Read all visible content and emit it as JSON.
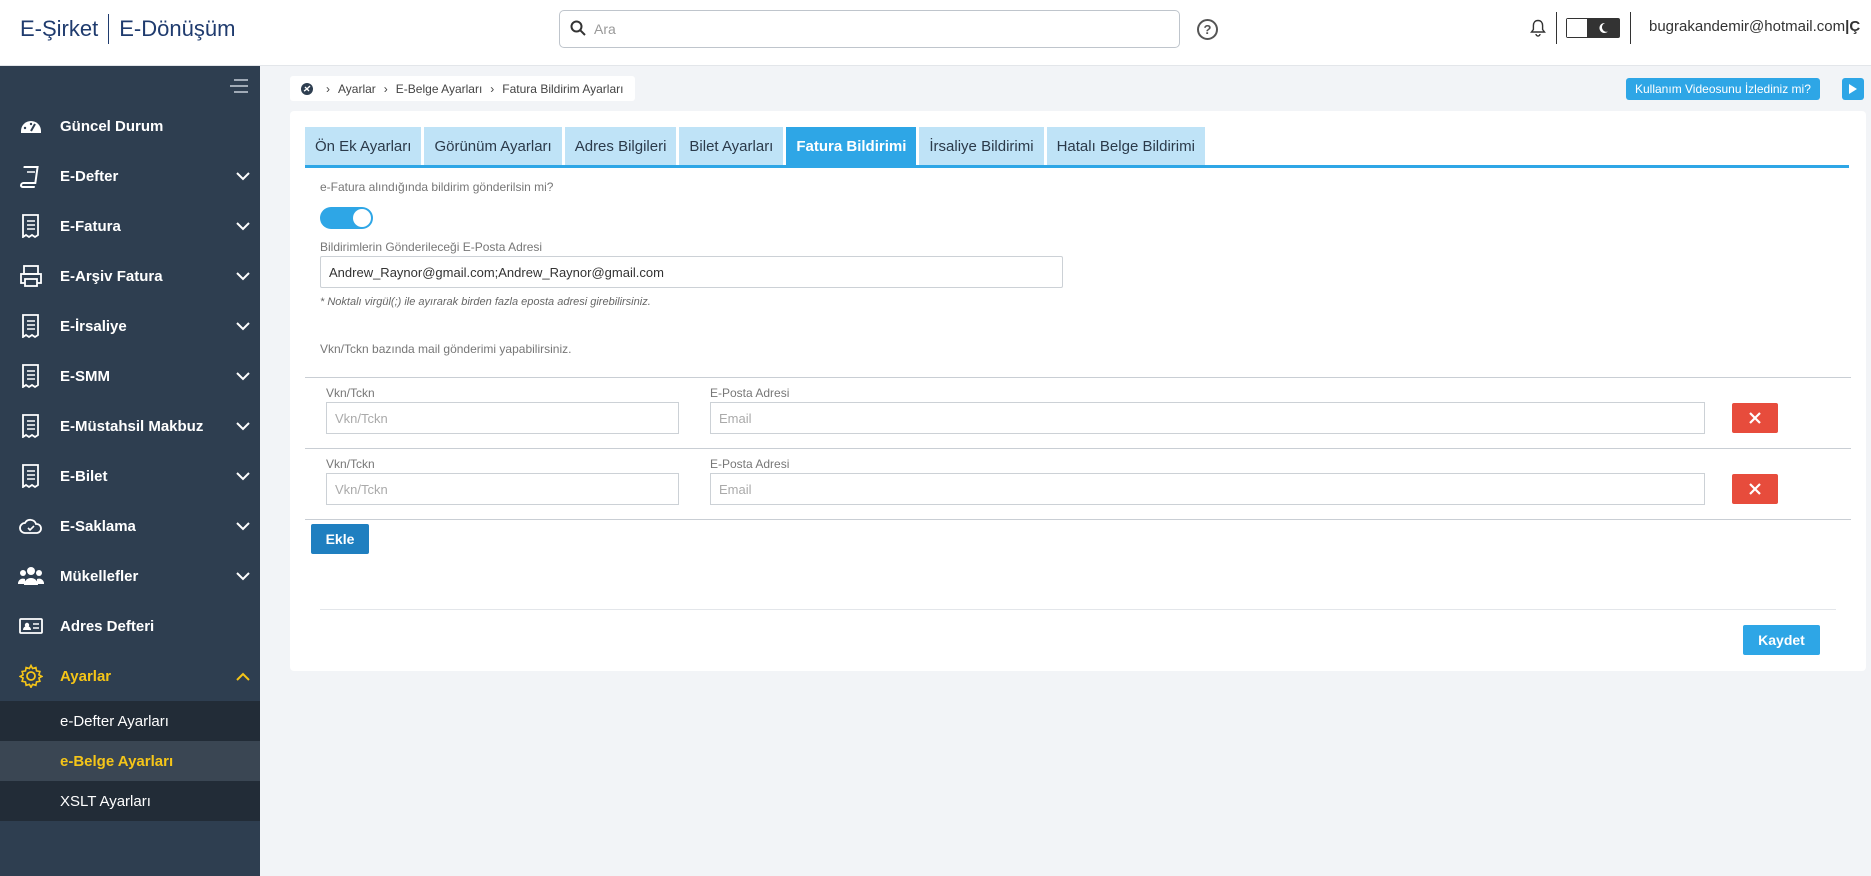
{
  "header": {
    "brand_left": "E-Şirket",
    "brand_right": "E-Dönüşüm",
    "search_placeholder": "Ara",
    "help_label": "?",
    "user_email": "bugrakandemir@hotmail.com",
    "user_suffix": "|Ç"
  },
  "sidebar": {
    "items": [
      {
        "label": "Güncel Durum",
        "icon": "dashboard-icon"
      },
      {
        "label": "E-Defter",
        "icon": "book-icon"
      },
      {
        "label": "E-Fatura",
        "icon": "receipt-icon"
      },
      {
        "label": "E-Arşiv Fatura",
        "icon": "printer-icon"
      },
      {
        "label": "E-İrsaliye",
        "icon": "receipt-icon"
      },
      {
        "label": "E-SMM",
        "icon": "receipt-icon"
      },
      {
        "label": "E-Müstahsil Makbuz",
        "icon": "receipt-icon"
      },
      {
        "label": "E-Bilet",
        "icon": "receipt-icon"
      },
      {
        "label": "E-Saklama",
        "icon": "cloud-icon"
      },
      {
        "label": "Mükellefler",
        "icon": "users-icon"
      },
      {
        "label": "Adres Defteri",
        "icon": "address-card-icon"
      },
      {
        "label": "Ayarlar",
        "icon": "gear-icon"
      }
    ],
    "subitems": [
      {
        "label": "e-Defter Ayarları"
      },
      {
        "label": "e-Belge Ayarları"
      },
      {
        "label": "XSLT Ayarları"
      }
    ]
  },
  "breadcrumb": {
    "items": [
      "Ayarlar",
      "E-Belge Ayarları",
      "Fatura Bildirim Ayarları"
    ]
  },
  "video_button": "Kullanım Videosunu İzlediniz mi?",
  "tabs": [
    {
      "label": "Ön Ek Ayarları"
    },
    {
      "label": "Görünüm Ayarları"
    },
    {
      "label": "Adres Bilgileri"
    },
    {
      "label": "Bilet Ayarları"
    },
    {
      "label": "Fatura Bildirimi",
      "active": true
    },
    {
      "label": "İrsaliye Bildirimi"
    },
    {
      "label": "Hatalı Belge Bildirimi"
    }
  ],
  "form": {
    "question": "e-Fatura alındığında bildirim gönderilsin mi?",
    "toggle_on": true,
    "email_label": "Bildirimlerin Gönderileceği E-Posta Adresi",
    "email_value": "Andrew_Raynor@gmail.com;Andrew_Raynor@gmail.com",
    "hint": "* Noktalı virgül(;) ile ayırarak birden fazla eposta adresi girebilirsiniz.",
    "vkn_note": "Vkn/Tckn bazında mail gönderimi yapabilirsiniz.",
    "rows": [
      {
        "vkn_label": "Vkn/Tckn",
        "vkn_placeholder": "Vkn/Tckn",
        "email_label": "E-Posta Adresi",
        "email_placeholder": "Email"
      },
      {
        "vkn_label": "Vkn/Tckn",
        "vkn_placeholder": "Vkn/Tckn",
        "email_label": "E-Posta Adresi",
        "email_placeholder": "Email"
      }
    ],
    "add_button": "Ekle",
    "save_button": "Kaydet"
  },
  "colors": {
    "accent": "#2ea6e6",
    "sidebar_bg": "#2e3e50",
    "active_nav": "#f5c518",
    "danger": "#e74c3c"
  }
}
